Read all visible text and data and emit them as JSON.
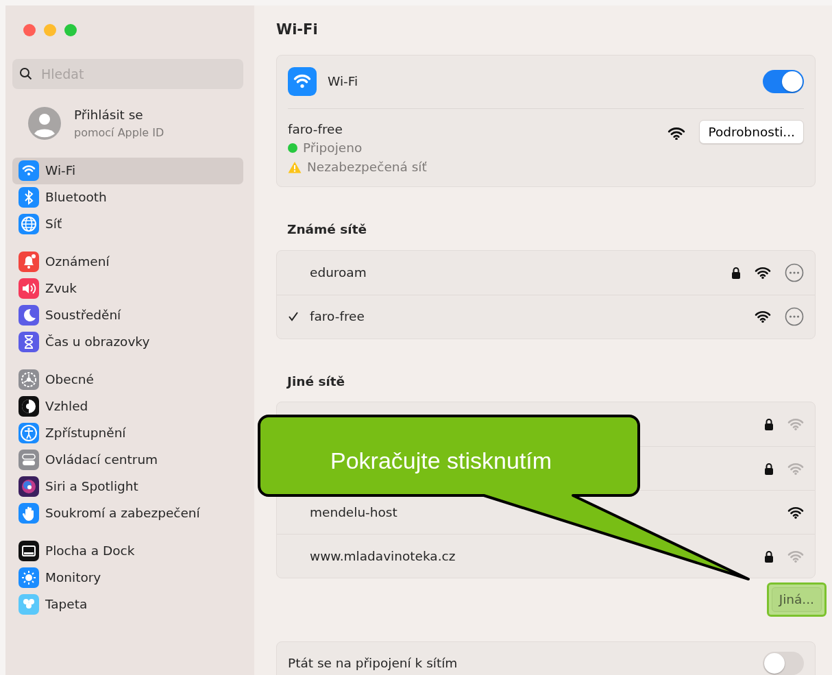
{
  "window": {
    "title": "Wi-Fi"
  },
  "sidebar": {
    "search": {
      "placeholder": "Hledat"
    },
    "account": {
      "title": "Přihlásit se",
      "subtitle": "pomocí Apple ID"
    },
    "groups": [
      [
        {
          "label": "Wi-Fi",
          "selected": true
        },
        {
          "label": "Bluetooth",
          "selected": false
        },
        {
          "label": "Síť",
          "selected": false
        }
      ],
      [
        {
          "label": "Oznámení",
          "selected": false
        },
        {
          "label": "Zvuk",
          "selected": false
        },
        {
          "label": "Soustředění",
          "selected": false
        },
        {
          "label": "Čas u obrazovky",
          "selected": false
        }
      ],
      [
        {
          "label": "Obecné",
          "selected": false
        },
        {
          "label": "Vzhled",
          "selected": false
        },
        {
          "label": "Zpřístupnění",
          "selected": false
        },
        {
          "label": "Ovládací centrum",
          "selected": false
        },
        {
          "label": "Siri a Spotlight",
          "selected": false
        },
        {
          "label": "Soukromí a zabezpečení",
          "selected": false
        }
      ],
      [
        {
          "label": "Plocha a Dock",
          "selected": false
        },
        {
          "label": "Monitory",
          "selected": false
        },
        {
          "label": "Tapeta",
          "selected": false
        }
      ]
    ]
  },
  "wifi": {
    "label": "Wi-Fi",
    "on": true,
    "current": {
      "name": "faro-free",
      "status": "Připojeno",
      "warning": "Nezabezpečená síť",
      "button": "Podrobnosti..."
    }
  },
  "known_networks": {
    "title": "Známé sítě",
    "rows": [
      {
        "name": "eduroam",
        "selected": false,
        "secured": true
      },
      {
        "name": "faro-free",
        "selected": true,
        "secured": false
      }
    ]
  },
  "other_networks": {
    "title": "Jiné sítě",
    "rows": [
      {
        "secured": true,
        "weak_signal": true
      },
      {
        "secured": true,
        "weak_signal": true
      },
      {
        "name": "mendelu-host",
        "secured": false,
        "weak_signal": false
      },
      {
        "name": "www.mladavinoteka.cz",
        "secured": true,
        "weak_signal": true
      }
    ],
    "button": "Jiná..."
  },
  "ask_to_join": {
    "label": "Ptát se na připojení k sítím",
    "on": false
  },
  "callout": {
    "text": "Pokračujte stisknutím"
  }
}
